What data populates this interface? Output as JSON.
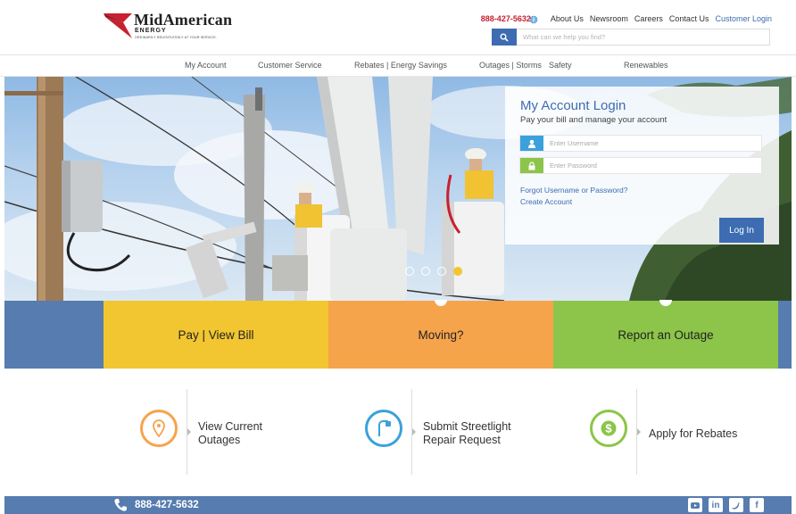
{
  "header": {
    "brand": "MidAmerican",
    "brand_sub": "ENERGY",
    "tagline": "ORDINARILY RELENTLESSLY AT YOUR SERVICE.",
    "phone": "888-427-5632",
    "links": [
      "About Us",
      "Newsroom",
      "Careers",
      "Contact Us",
      "Customer Login"
    ],
    "search_placeholder": "What can we help you find?"
  },
  "nav": [
    "My Account",
    "Customer Service",
    "Rebates | Energy Savings",
    "Outages | Storms",
    "Safety",
    "Renewables"
  ],
  "login": {
    "title": "My Account Login",
    "subtitle": "Pay your bill and manage your account",
    "username_placeholder": "Enter Username",
    "password_placeholder": "Enter Password",
    "forgot": "Forgot Username or Password?",
    "create": "Create Account",
    "button": "Log In"
  },
  "carousel": {
    "slide_count": 4,
    "active_index": 3
  },
  "tiles": [
    {
      "label": "Pay | View Bill",
      "color": "#f2c630"
    },
    {
      "label": "Moving?",
      "color": "#f6a44c"
    },
    {
      "label": "Report an Outage",
      "color": "#8cc54a"
    }
  ],
  "colors": {
    "brand_blue": "#3d6cb2",
    "footer_blue": "#577caf",
    "phone_red": "#c8202f"
  },
  "quick_links": [
    {
      "line1": "View Current",
      "line2": "Outages",
      "icon": "location-pin-icon",
      "color": "#f6a44c"
    },
    {
      "line1": "Submit Streetlight",
      "line2": "Repair Request",
      "icon": "streetlight-icon",
      "color": "#3aa1dc"
    },
    {
      "line1": "Apply for Rebates",
      "line2": "",
      "icon": "dollar-icon",
      "color": "#8cc54a"
    }
  ],
  "footer": {
    "phone": "888-427-5632",
    "social": [
      "youtube-icon",
      "linkedin-icon",
      "twitter-icon",
      "facebook-icon"
    ]
  }
}
